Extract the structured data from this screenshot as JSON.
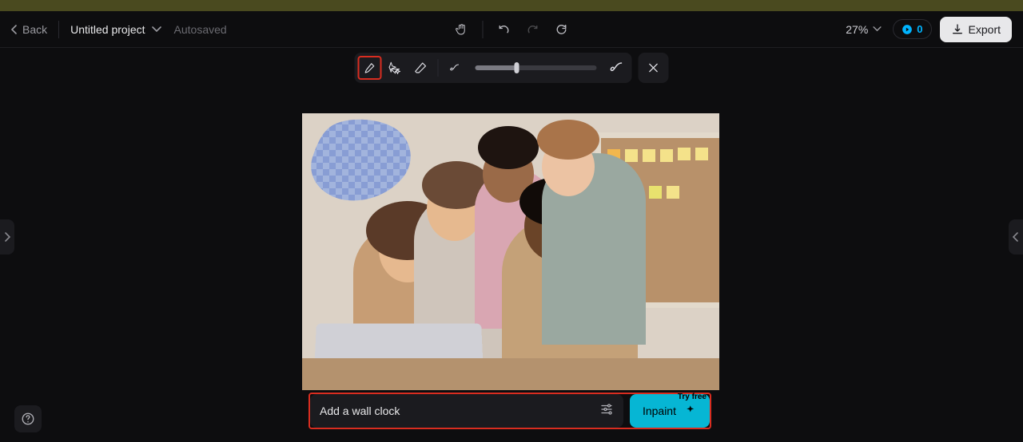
{
  "header": {
    "back_label": "Back",
    "project_title": "Untitled project",
    "autosaved_label": "Autosaved",
    "zoom_label": "27%",
    "credit_count": "0",
    "export_label": "Export"
  },
  "edit_toolbar": {
    "brush_active": true,
    "slider_value": 34
  },
  "prompt": {
    "text": "Add a wall clock",
    "inpaint_label": "Inpaint",
    "try_free_label": "Try free"
  },
  "highlights": {
    "brush_tool": true,
    "prompt_bar": true
  }
}
